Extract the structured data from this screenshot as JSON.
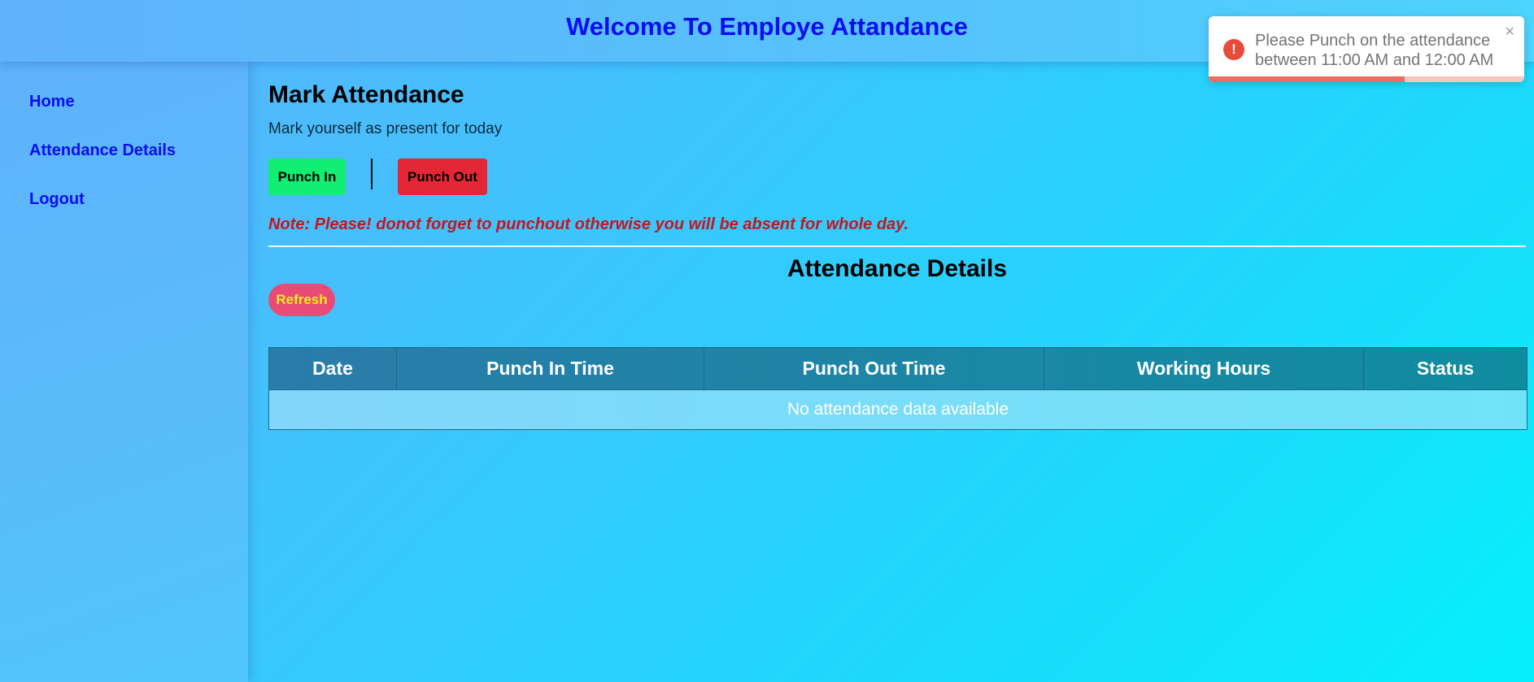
{
  "header": {
    "title": "Welcome To Employe Attandance"
  },
  "sidebar": {
    "items": [
      {
        "label": "Home"
      },
      {
        "label": "Attendance Details"
      },
      {
        "label": "Logout"
      }
    ]
  },
  "attendance": {
    "title": "Mark Attendance",
    "subtitle": "Mark yourself as present for today",
    "punch_in_label": "Punch In",
    "punch_out_label": "Punch Out",
    "note": "Note: Please! donot forget to punchout otherwise you will be absent for whole day."
  },
  "details": {
    "title": "Attendance Details",
    "refresh_label": "Refresh",
    "columns": [
      "Date",
      "Punch In Time",
      "Punch Out Time",
      "Working Hours",
      "Status"
    ],
    "empty_message": "No attendance data available"
  },
  "toast": {
    "message": "Please Punch on the attendance between 11:00 AM and 12:00 AM",
    "icon": "error-icon",
    "close_glyph": "×",
    "progress": 0.62,
    "accent_color": "#e84b3c"
  },
  "colors": {
    "title_blue": "#0b0df0",
    "punch_in": "#12ee72",
    "punch_out": "#e32735",
    "refresh_bg": "#e94a76",
    "refresh_text": "#f6ee1c",
    "note": "#c8141c"
  }
}
